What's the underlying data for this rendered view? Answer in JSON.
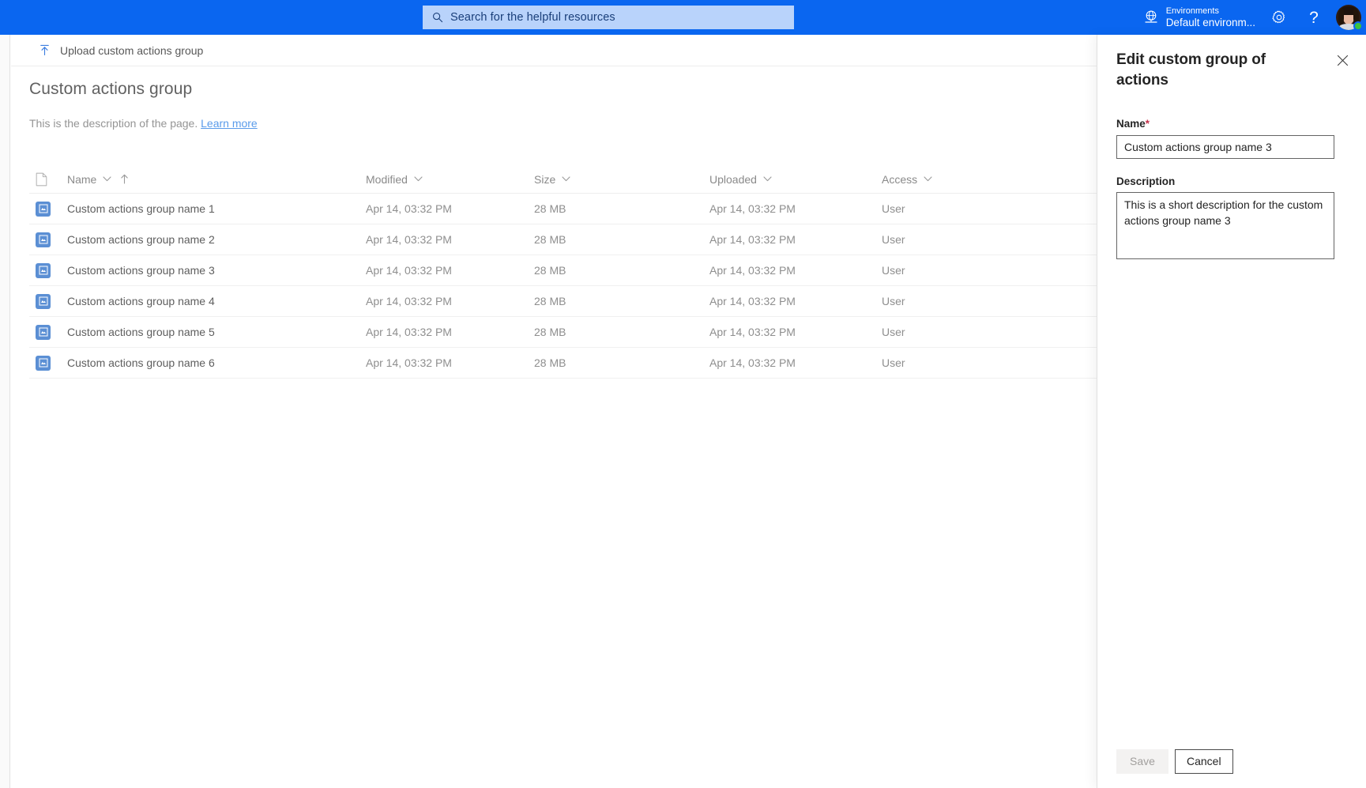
{
  "topbar": {
    "search": {
      "placeholder": "Search for the helpful resources",
      "icon": "search-icon"
    },
    "environment": {
      "label": "Environments",
      "value": "Default environm...",
      "icon": "globe-icon"
    },
    "settings_icon": "gear-icon",
    "help_icon": "help-icon",
    "help_glyph": "?",
    "avatar_icon": "user-avatar",
    "accent_color": "#0a66f0",
    "search_bg": "#b9d3fb"
  },
  "commandbar": {
    "upload_label": "Upload custom actions group",
    "upload_icon": "upload-icon"
  },
  "page": {
    "title": "Custom actions group",
    "description_text": "This is the description of the page.",
    "learn_more": "Learn more"
  },
  "table": {
    "columns": [
      {
        "key": "icon",
        "label": "",
        "icon": "document-icon",
        "sortable": false
      },
      {
        "key": "name",
        "label": "Name",
        "chevron": true,
        "sorted": "asc"
      },
      {
        "key": "modified",
        "label": "Modified",
        "chevron": true
      },
      {
        "key": "size",
        "label": "Size",
        "chevron": true
      },
      {
        "key": "uploaded",
        "label": "Uploaded",
        "chevron": true
      },
      {
        "key": "access",
        "label": "Access",
        "chevron": true
      }
    ],
    "rows": [
      {
        "icon": "custom-action-group-icon",
        "name": "Custom actions group name 1",
        "modified": "Apr 14, 03:32 PM",
        "size": "28 MB",
        "uploaded": "Apr 14, 03:32 PM",
        "access": "User"
      },
      {
        "icon": "custom-action-group-icon",
        "name": "Custom actions group name 2",
        "modified": "Apr 14, 03:32 PM",
        "size": "28 MB",
        "uploaded": "Apr 14, 03:32 PM",
        "access": "User"
      },
      {
        "icon": "custom-action-group-icon",
        "name": "Custom actions group name 3",
        "modified": "Apr 14, 03:32 PM",
        "size": "28 MB",
        "uploaded": "Apr 14, 03:32 PM",
        "access": "User"
      },
      {
        "icon": "custom-action-group-icon",
        "name": "Custom actions group name 4",
        "modified": "Apr 14, 03:32 PM",
        "size": "28 MB",
        "uploaded": "Apr 14, 03:32 PM",
        "access": "User"
      },
      {
        "icon": "custom-action-group-icon",
        "name": "Custom actions group name 5",
        "modified": "Apr 14, 03:32 PM",
        "size": "28 MB",
        "uploaded": "Apr 14, 03:32 PM",
        "access": "User"
      },
      {
        "icon": "custom-action-group-icon",
        "name": "Custom actions group name 6",
        "modified": "Apr 14, 03:32 PM",
        "size": "28 MB",
        "uploaded": "Apr 14, 03:32 PM",
        "access": "User"
      }
    ]
  },
  "panel": {
    "title": "Edit custom group of actions",
    "close_icon": "close-icon",
    "name_field": {
      "label": "Name",
      "required_marker": "*",
      "value": "Custom actions group name 3"
    },
    "description_field": {
      "label": "Description",
      "value": "This is a short description for the custom actions group name 3"
    },
    "save_label": "Save",
    "cancel_label": "Cancel",
    "save_disabled": true,
    "required_color": "#c4314b"
  }
}
